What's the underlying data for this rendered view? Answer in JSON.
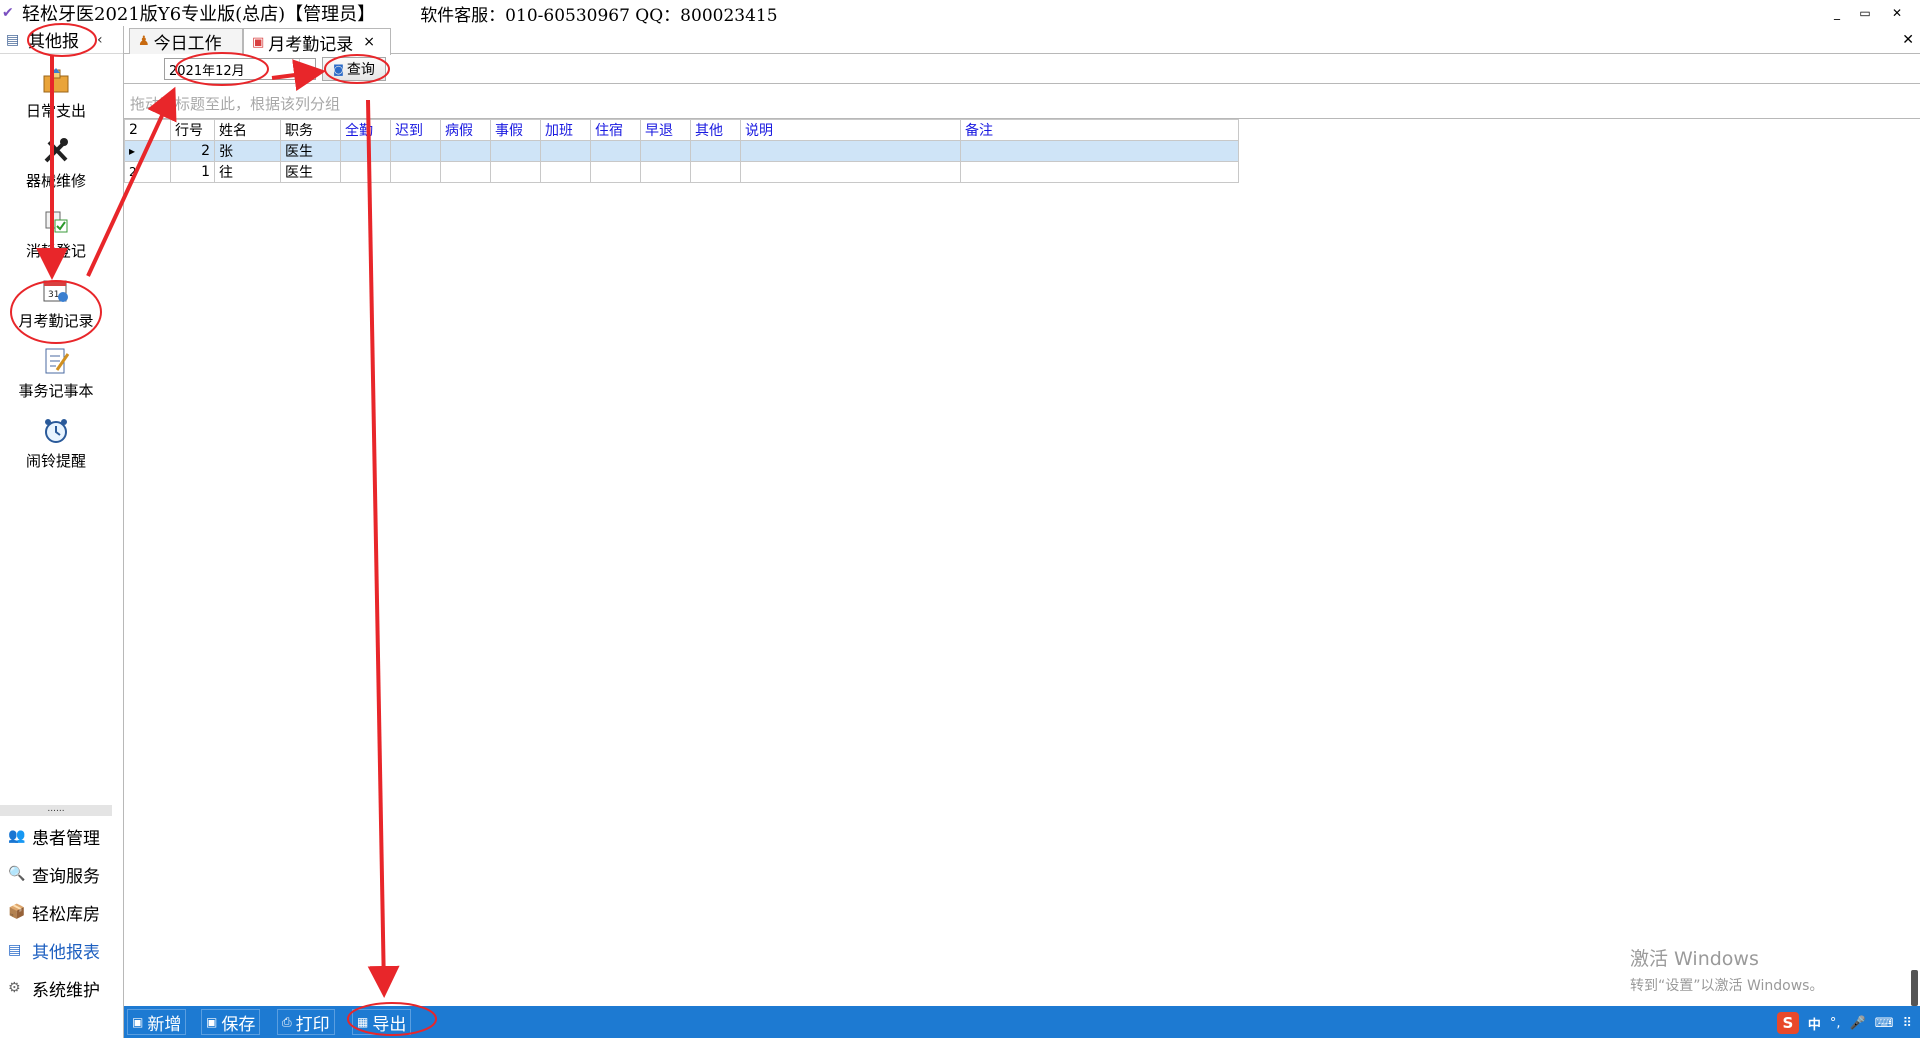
{
  "window": {
    "title": "轻松牙医2021版Y6专业版(总店)【管理员】",
    "support": "软件客服：010-60530967 QQ：800023415",
    "controls": [
      "_",
      "▭",
      "✕"
    ]
  },
  "sidebar": {
    "header": "其他报",
    "tools": [
      {
        "label": "日常支出",
        "icon": "expense-icon"
      },
      {
        "label": "器械维修",
        "icon": "repair-tools-icon"
      },
      {
        "label": "消耗登记",
        "icon": "consumption-icon"
      },
      {
        "label": "月考勤记录",
        "icon": "calendar-icon"
      },
      {
        "label": "事务记事本",
        "icon": "notebook-icon"
      },
      {
        "label": "闹铃提醒",
        "icon": "alarm-clock-icon"
      }
    ],
    "grip": "......",
    "nav": [
      {
        "label": "患者管理",
        "icon": "patients-icon"
      },
      {
        "label": "查询服务",
        "icon": "query-icon"
      },
      {
        "label": "轻松库房",
        "icon": "warehouse-icon"
      },
      {
        "label": "其他报表",
        "icon": "report-icon"
      },
      {
        "label": "系统维护",
        "icon": "settings-icon"
      }
    ]
  },
  "tabs": [
    {
      "label": "今日工作",
      "icon": "today-icon"
    },
    {
      "label": "月考勤记录",
      "icon": "calendar-icon",
      "close": "×"
    }
  ],
  "toolbar": {
    "month": "2021年12月",
    "query_label": "查询"
  },
  "group_hint": "拖动列标题至此，根据该列分组",
  "grid": {
    "corner": "2",
    "columns": [
      "行号",
      "姓名",
      "职务",
      "全勤",
      "迟到",
      "病假",
      "事假",
      "加班",
      "住宿",
      "早退",
      "其他",
      "说明",
      "备注"
    ],
    "rows": [
      {
        "marker": "▸",
        "no": "2",
        "name": "张",
        "role": "医生"
      },
      {
        "marker": "2",
        "no": "1",
        "name": "往",
        "role": "医生"
      }
    ]
  },
  "bottom": {
    "buttons": [
      {
        "label": "新增",
        "icon": "add-icon"
      },
      {
        "label": "保存",
        "icon": "save-icon"
      },
      {
        "label": "打印",
        "icon": "print-icon"
      },
      {
        "label": "导出",
        "icon": "export-icon"
      }
    ],
    "tray": [
      "S",
      "中",
      "°,",
      "🎤",
      "⌨",
      "⠿"
    ]
  },
  "watermark": {
    "line1": "激活 Windows",
    "line2": "转到“设置”以激活 Windows。"
  },
  "colors": {
    "annotation": "#e8262a",
    "bottom_bar": "#1d7ad2",
    "selected_row": "#cfe4f7",
    "blue_header": "#1a1ae0"
  }
}
